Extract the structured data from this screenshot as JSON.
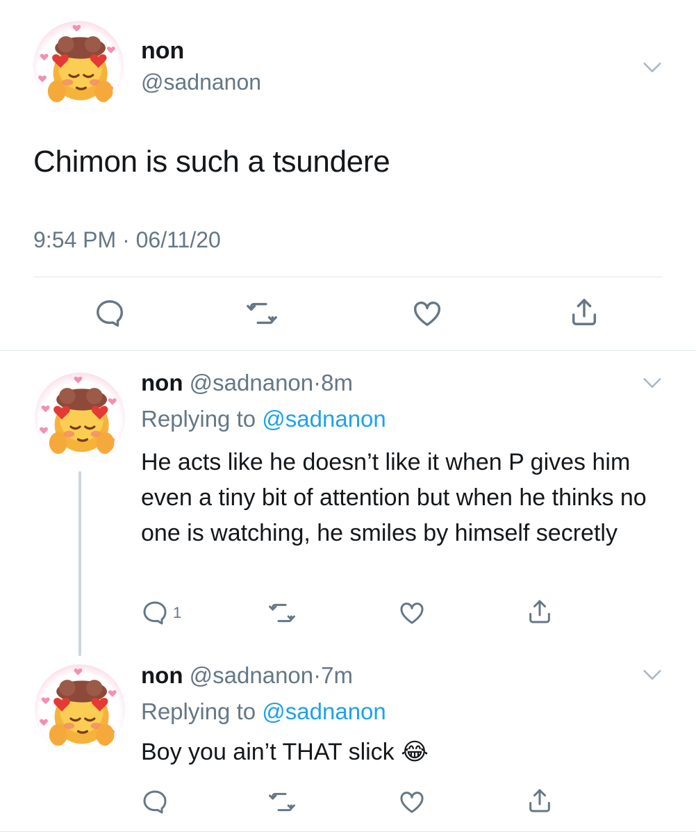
{
  "main_tweet": {
    "display_name": "non",
    "handle": "@sadnanon",
    "text": "Chimon is such a tsundere",
    "time": "9:54 PM",
    "separator": "·",
    "date": "06/11/20"
  },
  "replies": [
    {
      "display_name": "non",
      "handle": "@sadnanon",
      "separator": "·",
      "age": "8m",
      "replying_prefix": "Replying to",
      "replying_to": "@sadnanon",
      "text": "He acts like he doesn’t like it when P gives him even a tiny bit of attention but when he thinks no one is watching, he smiles by himself secretly",
      "reply_count": "1"
    },
    {
      "display_name": "non",
      "handle": "@sadnanon",
      "separator": "·",
      "age": "7m",
      "replying_prefix": "Replying to",
      "replying_to": "@sadnanon",
      "text": "Boy you ain’t THAT slick",
      "emoji": "😂"
    }
  ],
  "icons": {
    "reply": "speech-bubble-icon",
    "retweet": "retweet-arrows-icon",
    "like": "heart-icon",
    "share": "share-upload-icon",
    "caret": "chevron-down-icon",
    "avatar": "smiling-face-with-hearts-emoji"
  },
  "colors": {
    "text": "#14171a",
    "muted": "#657786",
    "link": "#1da1f2",
    "divider": "#e1e8ed",
    "thread_line": "#ccd6dd"
  }
}
